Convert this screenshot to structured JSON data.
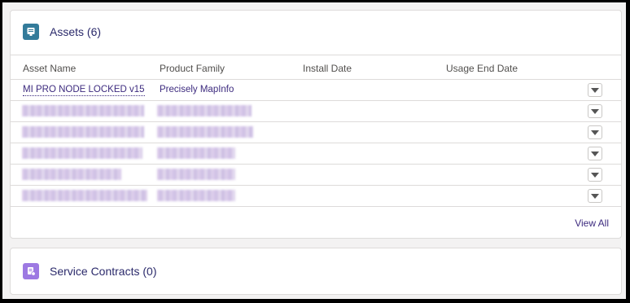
{
  "assets_card": {
    "title": "Assets (6)",
    "icon": "asset-icon",
    "icon_color": "#337b9a",
    "columns": [
      "Asset Name",
      "Product Family",
      "Install Date",
      "Usage End Date"
    ],
    "rows": [
      {
        "name": "MI PRO NODE LOCKED v15",
        "family": "Precisely MapInfo",
        "install_date": "",
        "usage_end_date": "",
        "redacted": false
      },
      {
        "name": "",
        "family": "",
        "install_date": "",
        "usage_end_date": "",
        "redacted": true
      },
      {
        "name": "",
        "family": "",
        "install_date": "",
        "usage_end_date": "",
        "redacted": true
      },
      {
        "name": "",
        "family": "",
        "install_date": "",
        "usage_end_date": "",
        "redacted": true
      },
      {
        "name": "",
        "family": "",
        "install_date": "",
        "usage_end_date": "",
        "redacted": true
      },
      {
        "name": "",
        "family": "",
        "install_date": "",
        "usage_end_date": "",
        "redacted": true
      }
    ],
    "row_menu_icon": "chevron-down-icon",
    "view_all": "View All"
  },
  "contracts_card": {
    "title": "Service Contracts (0)",
    "icon": "service-contract-icon",
    "icon_color": "#9d79e2"
  },
  "colors": {
    "link": "#3c2a7e",
    "border": "#dddbda",
    "page_background": "#f3f2f2"
  }
}
